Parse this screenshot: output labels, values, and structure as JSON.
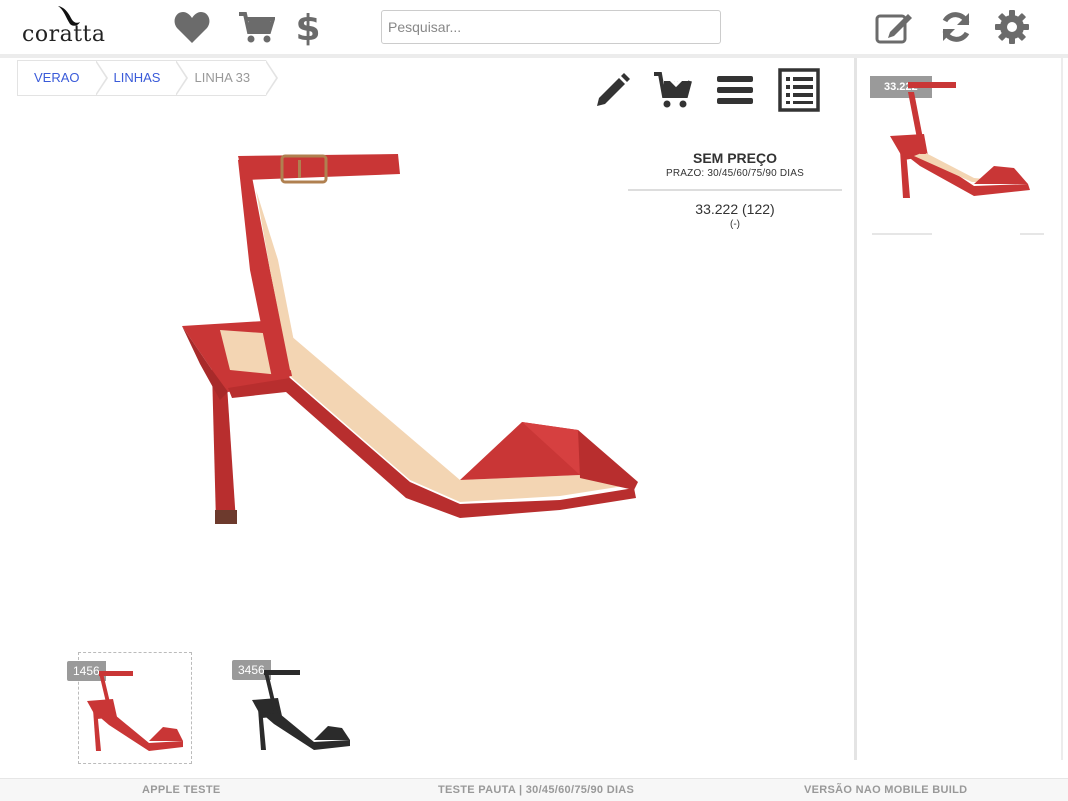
{
  "brand": {
    "logo_text": "coratta"
  },
  "header": {
    "search_placeholder": "Pesquisar...",
    "icons": [
      "heart-icon",
      "cart-icon",
      "dollar-icon",
      "edit-icon",
      "refresh-icon",
      "gear-icon"
    ]
  },
  "breadcrumb": {
    "items": [
      {
        "label": "VERAO"
      },
      {
        "label": "LINHAS"
      },
      {
        "label": "LINHA 33"
      }
    ]
  },
  "actions": {
    "icons": [
      "pencil-icon",
      "add-to-cart-icon",
      "menu-icon",
      "details-list-icon"
    ]
  },
  "product": {
    "price_label": "SEM PREÇO",
    "payment_terms": "PRAZO: 30/45/60/75/90 DIAS",
    "reference": "33.222 (122)",
    "reference_extra": "(-)",
    "image_color": "#c93636"
  },
  "variants": [
    {
      "code": "1456",
      "color": "#c93636",
      "selected": true
    },
    {
      "code": "3456",
      "color": "#2b2b2b",
      "selected": false
    }
  ],
  "sidebar": {
    "cards": [
      {
        "code": "33.222",
        "color": "#c93636"
      }
    ]
  },
  "footer": {
    "left": "APPLE TESTE",
    "center": "TESTE PAUTA | 30/45/60/75/90 DIAS",
    "right": "VERSÃO NAO MOBILE BUILD"
  }
}
